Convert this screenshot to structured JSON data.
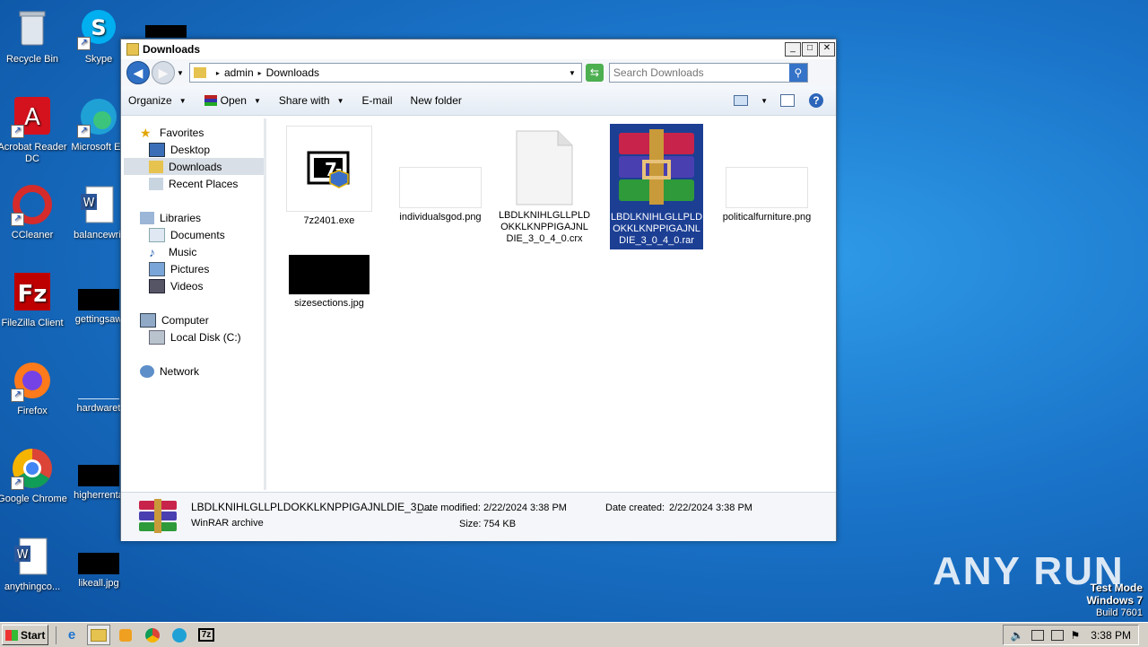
{
  "desktop": {
    "icons": [
      {
        "label": "Recycle Bin",
        "icon": "recycle-bin-icon"
      },
      {
        "label": "Skype",
        "icon": "skype-icon"
      },
      {
        "label": "Acrobat Reader DC",
        "icon": "acrobat-icon"
      },
      {
        "label": "Microsoft Ed",
        "icon": "edge-icon"
      },
      {
        "label": "CCleaner",
        "icon": "ccleaner-icon"
      },
      {
        "label": "balancewrit",
        "icon": "word-doc-icon"
      },
      {
        "label": "FileZilla Client",
        "icon": "filezilla-icon"
      },
      {
        "label": "gettingsaw",
        "icon": "image-file-icon"
      },
      {
        "label": "Firefox",
        "icon": "firefox-icon"
      },
      {
        "label": "hardwaret",
        "icon": "image-file-icon"
      },
      {
        "label": "Google Chrome",
        "icon": "chrome-icon"
      },
      {
        "label": "higherrenta",
        "icon": "image-file-icon"
      },
      {
        "label": "anythingco...",
        "icon": "word-doc-icon"
      },
      {
        "label": "likeall.jpg",
        "icon": "image-file-icon"
      }
    ]
  },
  "window": {
    "title": "Downloads",
    "controls": {
      "minimize": "_",
      "maximize": "□",
      "close": "✕"
    },
    "address": {
      "crumbs": [
        "admin",
        "Downloads"
      ]
    },
    "search": {
      "placeholder": "Search Downloads"
    },
    "toolbar": {
      "organize": "Organize",
      "open": "Open",
      "share_with": "Share with",
      "email": "E-mail",
      "new_folder": "New folder",
      "help": "?"
    },
    "nav": {
      "favorites": "Favorites",
      "desktop": "Desktop",
      "downloads": "Downloads",
      "recent": "Recent Places",
      "libraries": "Libraries",
      "documents": "Documents",
      "music": "Music",
      "pictures": "Pictures",
      "videos": "Videos",
      "computer": "Computer",
      "local_disk": "Local Disk (C:)",
      "network": "Network"
    },
    "files": [
      {
        "name": "7z2401.exe"
      },
      {
        "name": "individualsgod.png"
      },
      {
        "name": "LBDLKNIHLGLLPLDOKKLKNPPIGAJNLDIE_3_0_4_0.crx"
      },
      {
        "name": "LBDLKNIHLGLLPLDOKKLKNPPIGAJNLDIE_3_0_4_0.rar"
      },
      {
        "name": "politicalfurniture.png"
      },
      {
        "name": "sizesections.jpg"
      }
    ],
    "details": {
      "filename": "LBDLKNIHLGLLPLDOKKLKNPPIGAJNLDIE_3_...",
      "type": "WinRAR archive",
      "modified_label": "Date modified:",
      "modified_value": "2/22/2024 3:38 PM",
      "size_label": "Size:",
      "size_value": "754 KB",
      "created_label": "Date created:",
      "created_value": "2/22/2024 3:38 PM"
    }
  },
  "taskbar": {
    "start": "Start",
    "clock": "3:38 PM"
  },
  "watermark": {
    "line1": "Test Mode",
    "line2": "Windows 7",
    "line3": "Build 7601",
    "brand": "ANY RUN"
  }
}
